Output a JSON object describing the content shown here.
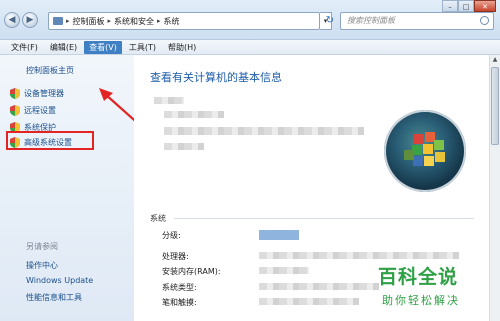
{
  "address": {
    "crumbs": [
      "控制面板",
      "系统和安全",
      "系统"
    ],
    "search_placeholder": "搜索控制面板"
  },
  "menu": {
    "items": [
      "文件(F)",
      "编辑(E)",
      "查看(V)",
      "工具(T)",
      "帮助(H)"
    ],
    "active_index": 2
  },
  "sidebar": {
    "home": "控制面板主页",
    "tasks": [
      "设备管理器",
      "远程设置",
      "系统保护",
      "高级系统设置"
    ],
    "see_also_title": "另请参阅",
    "see_also": [
      "操作中心",
      "Windows Update",
      "性能信息和工具"
    ]
  },
  "main": {
    "title": "查看有关计算机的基本信息",
    "section": "系统",
    "fields": [
      "分级:",
      "处理器:",
      "安装内存(RAM):",
      "系统类型:",
      "笔和触摸:"
    ]
  },
  "watermark": {
    "main": "百科全说",
    "sub": "助你轻松解决"
  },
  "colors": {
    "accent": "#3f7fc4",
    "link": "#1b4f8c",
    "highlight": "#e32424",
    "watermark": "#2fa046"
  }
}
